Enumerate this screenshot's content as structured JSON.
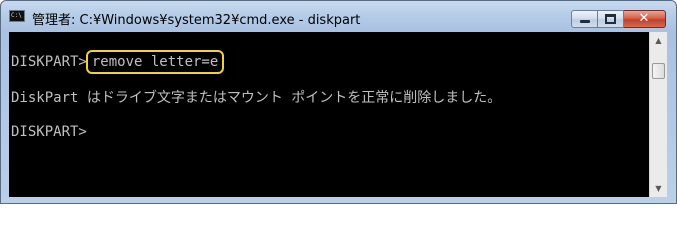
{
  "window": {
    "title": "管理者: C:¥Windows¥system32¥cmd.exe - diskpart",
    "app_icon_text": "C:\\",
    "controls": {
      "minimize": "minimize-icon",
      "maximize": "maximize-icon",
      "close": "close-icon",
      "close_glyph": "✕"
    }
  },
  "console": {
    "line1_prompt": "DISKPART>",
    "line1_command": "remove letter=e",
    "line2_output": "DiskPart はドライブ文字またはマウント ポイントを正常に削除しました。",
    "line3_prompt": "DISKPART>"
  },
  "scrollbar": {
    "up_glyph": "▲",
    "down_glyph": "▼"
  },
  "colors": {
    "console_bg": "#000000",
    "console_text": "#c0c0c0",
    "highlight_border": "#f2d13a",
    "titlebar": "#b9d0ea"
  }
}
